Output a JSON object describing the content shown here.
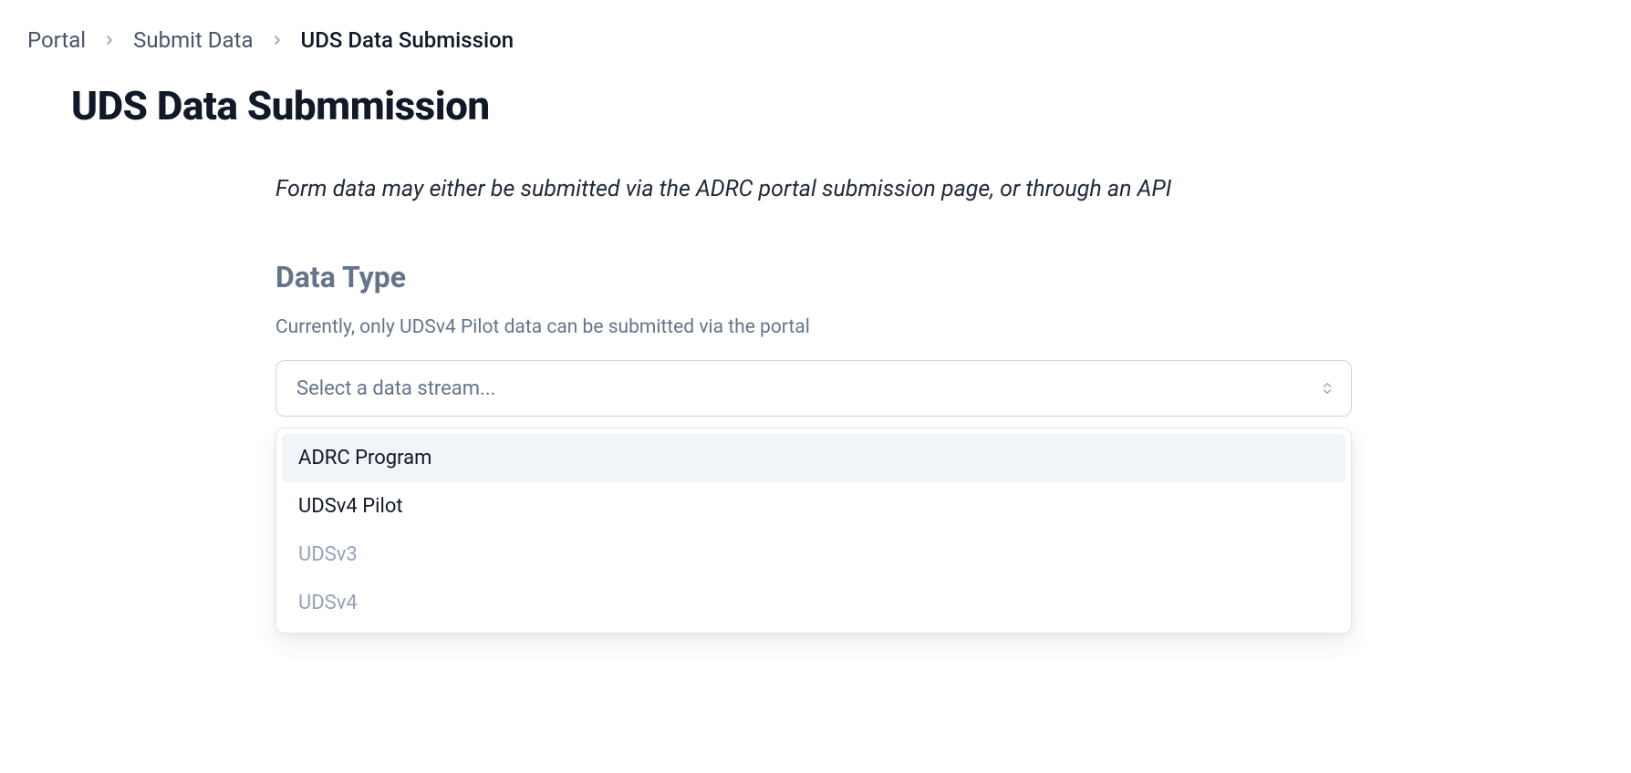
{
  "breadcrumb": {
    "items": [
      {
        "label": "Portal",
        "current": false
      },
      {
        "label": "Submit Data",
        "current": false
      },
      {
        "label": "UDS Data Submission",
        "current": true
      }
    ]
  },
  "page": {
    "title": "UDS Data Submmission",
    "intro": "Form data may either be submitted via the ADRC portal submission page, or through an API"
  },
  "section": {
    "heading": "Data Type",
    "sub": "Currently, only UDSv4 Pilot data can be submitted via the portal"
  },
  "select": {
    "placeholder": "Select a data stream...",
    "options": [
      {
        "label": "ADRC Program",
        "disabled": false,
        "highlighted": true
      },
      {
        "label": "UDSv4 Pilot",
        "disabled": false,
        "highlighted": false
      },
      {
        "label": "UDSv3",
        "disabled": true,
        "highlighted": false
      },
      {
        "label": "UDSv4",
        "disabled": true,
        "highlighted": false
      }
    ]
  }
}
